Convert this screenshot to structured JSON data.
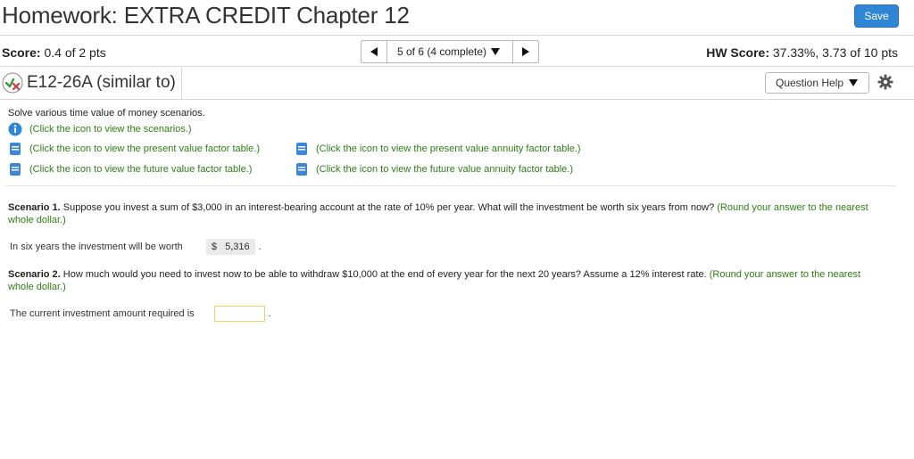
{
  "header": {
    "title": "Homework: EXTRA CREDIT Chapter 12",
    "save_label": "Save"
  },
  "score_bar": {
    "score_label": "Score:",
    "score_value": "0.4 of 2 pts",
    "nav_position": "5 of 6 (4 complete)",
    "hw_score_label": "HW Score:",
    "hw_score_value": "37.33%, 3.73 of 10 pts"
  },
  "question": {
    "id": "E12-26A (similar to)",
    "help_label": "Question Help",
    "intro": "Solve various time value of money scenarios.",
    "links": {
      "scenarios": "(Click the icon to view the scenarios.)",
      "pv_factor": "(Click the icon to view the present value factor table.)",
      "fv_factor": "(Click the icon to view the future value factor table.)",
      "pv_annuity": "(Click the icon to view the present value annuity factor table.)",
      "fv_annuity": "(Click the icon to view the future value annuity factor table.)"
    },
    "scenario1": {
      "label": "Scenario 1.",
      "text": " Suppose you invest a sum of $3,000 in an interest-bearing account at the rate of 10% per year. What will the investment be worth six years from now? ",
      "hint": "(Round your answer to the nearest whole dollar.)",
      "answer_prompt": "In six years the investment will be worth",
      "answer_value": "$   5,316",
      "answer_suffix": "."
    },
    "scenario2": {
      "label": "Scenario 2.",
      "text": " How much would you need to invest now to be able to withdraw $10,000 at the end of every year for the next 20 years? Assume a 12% interest rate. ",
      "hint": "(Round your answer to the nearest whole dollar.)",
      "answer_prompt": "The current investment amount required is",
      "answer_value": "",
      "answer_suffix": "."
    }
  },
  "colors": {
    "accent_blue": "#2f86d6",
    "hint_green": "#2e7d14",
    "status_green": "#3a9a3a",
    "status_red": "#d63b3b"
  },
  "icons": [
    "check-x-icon",
    "gear-icon",
    "info-icon",
    "book-icon",
    "caret-down-icon",
    "triangle-left-icon",
    "triangle-right-icon"
  ]
}
